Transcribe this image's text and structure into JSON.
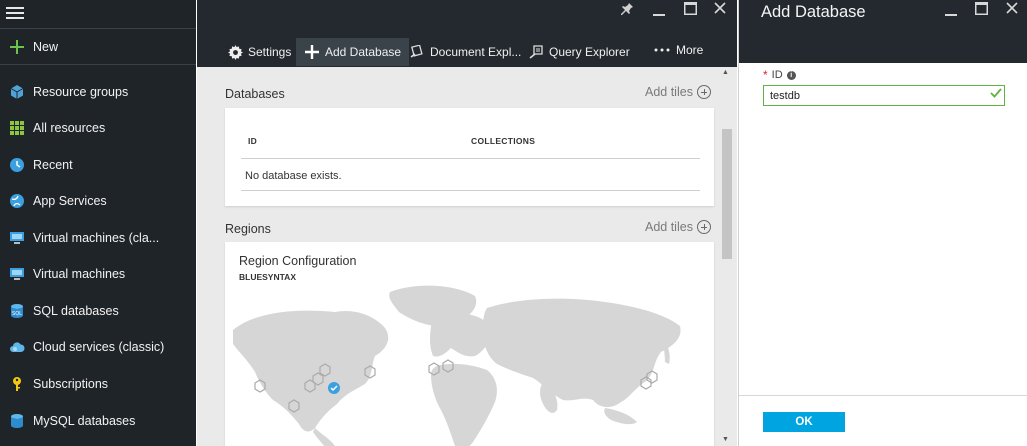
{
  "sidebar": {
    "new_label": "New",
    "items": [
      {
        "label": "Resource groups",
        "icon": "cube-icon"
      },
      {
        "label": "All resources",
        "icon": "grid-icon"
      },
      {
        "label": "Recent",
        "icon": "clock-icon"
      },
      {
        "label": "App Services",
        "icon": "globe-icon"
      },
      {
        "label": "Virtual machines (cla...",
        "icon": "monitor-icon"
      },
      {
        "label": "Virtual machines",
        "icon": "monitor-icon"
      },
      {
        "label": "SQL databases",
        "icon": "database-icon"
      },
      {
        "label": "Cloud services (classic)",
        "icon": "cloud-icon"
      },
      {
        "label": "Subscriptions",
        "icon": "key-icon"
      },
      {
        "label": "MySQL databases",
        "icon": "database-icon"
      }
    ]
  },
  "blade": {
    "commands": [
      {
        "label": "Settings",
        "icon": "gear-icon"
      },
      {
        "label": "Add Database",
        "icon": "plus-icon"
      },
      {
        "label": "Document Expl...",
        "icon": "document-explorer-icon"
      },
      {
        "label": "Query Explorer",
        "icon": "query-explorer-icon"
      },
      {
        "label": "More",
        "icon": "ellipsis-icon"
      }
    ],
    "databases": {
      "title": "Databases",
      "add_tiles": "Add tiles",
      "columns": [
        "ID",
        "COLLECTIONS"
      ],
      "empty_message": "No database exists."
    },
    "regions": {
      "title": "Regions",
      "add_tiles": "Add tiles",
      "tile_title": "Region Configuration",
      "tile_subtitle": "BLUESYNTAX"
    }
  },
  "panel": {
    "title": "Add Database",
    "id_label": "ID",
    "id_value": "testdb",
    "ok_label": "OK"
  },
  "colors": {
    "sidebar_bg": "#1f2428",
    "accent": "#00a4e0",
    "valid_green": "#5eb344",
    "required_red": "#d9262c"
  }
}
